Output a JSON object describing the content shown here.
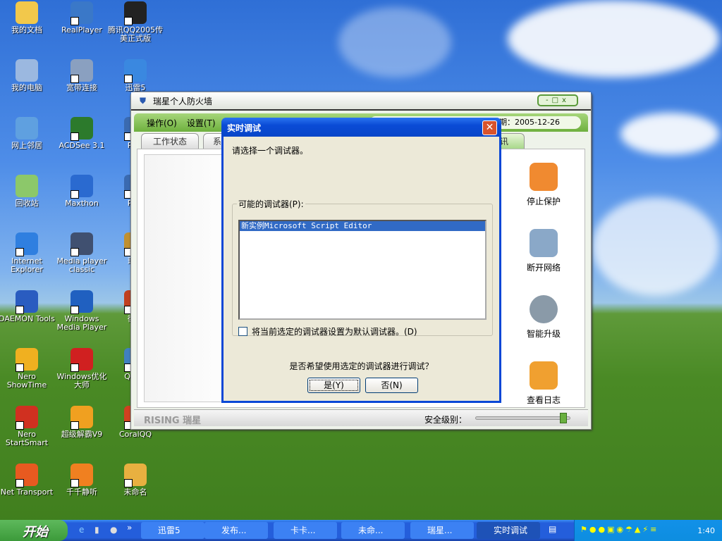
{
  "desktop": {
    "icons": [
      {
        "label": "我的文档",
        "color": "#f2c84b"
      },
      {
        "label": "我的电脑",
        "color": "#9bb8e0"
      },
      {
        "label": "网上邻居",
        "color": "#5fa0e0"
      },
      {
        "label": "回收站",
        "color": "#8cc86a"
      },
      {
        "label": "Internet Explorer",
        "color": "#2f7fe0"
      },
      {
        "label": "DAEMON Tools",
        "color": "#2a5cc0"
      },
      {
        "label": "Nero ShowTime",
        "color": "#f0b020"
      },
      {
        "label": "Nero StartSmart",
        "color": "#d03020"
      },
      {
        "label": "Net Transport",
        "color": "#e85a20"
      },
      {
        "label": "RealPlayer",
        "color": "#3a78c8"
      },
      {
        "label": "宽带连接",
        "color": "#8aa0c0"
      },
      {
        "label": "ACDSee 3.1",
        "color": "#2c7a2c"
      },
      {
        "label": "Maxthon",
        "color": "#2a6ad0"
      },
      {
        "label": "Media player classic",
        "color": "#405070"
      },
      {
        "label": "Windows Media Player",
        "color": "#2060c0"
      },
      {
        "label": "Windows优化大师",
        "color": "#d02020"
      },
      {
        "label": "超级解霸V9",
        "color": "#f0a020"
      },
      {
        "label": "千千静听",
        "color": "#f08020"
      },
      {
        "label": "腾讯QQ2005传美正式版",
        "color": "#222222"
      },
      {
        "label": "迅雷5",
        "color": "#3a88e0"
      },
      {
        "label": "PPLi",
        "color": "#3a6ab0"
      },
      {
        "label": "PPLi",
        "color": "#3a6ab0"
      },
      {
        "label": "瑞星",
        "color": "#c09030"
      },
      {
        "label": "街头",
        "color": "#c04020"
      },
      {
        "label": "QQBa",
        "color": "#4080c0"
      },
      {
        "label": "CoralQQ",
        "color": "#d04020"
      },
      {
        "label": "未命名",
        "color": "#e8b040"
      }
    ]
  },
  "firewall": {
    "title": "瑞星个人防火墙",
    "window_controls": "-□x",
    "menu": [
      "操作(O)",
      "设置(T)"
    ],
    "date": "期：2005-12-26",
    "tabs": [
      "工作状态",
      "系",
      "讯"
    ],
    "side_buttons": [
      "停止保护",
      "断开网络",
      "智能升级",
      "查看日志"
    ],
    "logo": "RISING 瑞星",
    "security_label": "安全级别：",
    "security_level": 0.95
  },
  "dialog": {
    "title": "实时调试",
    "close": "✕",
    "prompt": "请选择一个调试器。",
    "group_label": "可能的调试器(P):",
    "debuggers": [
      "新实例Microsoft Script Editor"
    ],
    "checkbox_label": "将当前选定的调试器设置为默认调试器。(D)",
    "question": "是否希望使用选定的调试器进行调试？",
    "yes": "是(Y)",
    "no": "否(N)"
  },
  "taskbar": {
    "start": "开始",
    "chevron": "»",
    "items": [
      "迅雷5",
      "发布...",
      "卡卡...",
      "未命...",
      "瑞星...",
      "实时调试"
    ],
    "active": "实时调试",
    "clock": "1:40"
  }
}
